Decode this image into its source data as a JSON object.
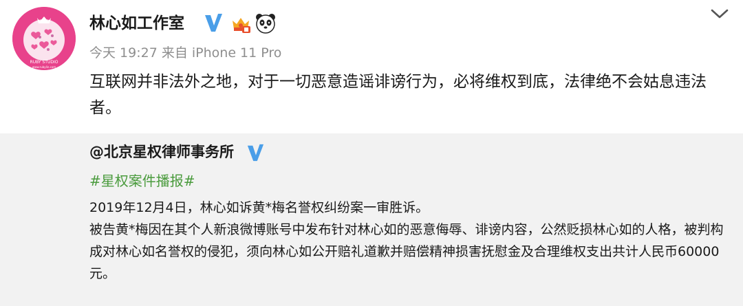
{
  "post": {
    "author": "林心如工作室",
    "avatar_text_top": "RUBY STUDIO",
    "avatar_text_bottom": "www.rubylin.com",
    "meta": "今天 19:27 来自 iPhone 11 Pro",
    "content": "互联网并非法外之地，对于一切恶意造谣诽谤行为，必将维权到底，法律绝不会姑息违法者。",
    "badges": [
      "verified-icon",
      "crown-badge-icon",
      "panda-badge-icon"
    ],
    "menu_icon": "chevron-down-icon"
  },
  "repost": {
    "author": "@北京星权律师事务所",
    "topic": "#星权案件播报#",
    "paragraphs": [
      "2019年12月4日，林心如诉黄*梅名誉权纠纷案一审胜诉。",
      "被告黄*梅因在其个人新浪微博账号中发布针对林心如的恶意侮辱、诽谤内容，公然贬损林心如的人格，被判构成对林心如名誉权的侵犯，须向林心如公开赔礼道歉并赔偿精神损害抚慰金及合理维权支出共计人民币60000元。"
    ]
  },
  "colors": {
    "verified": "#4a9ee8",
    "topic": "#4a9b3d",
    "meta": "#8e8e8e",
    "repost_bg": "#f2f2f2",
    "avatar_bg": "#e8428b"
  }
}
